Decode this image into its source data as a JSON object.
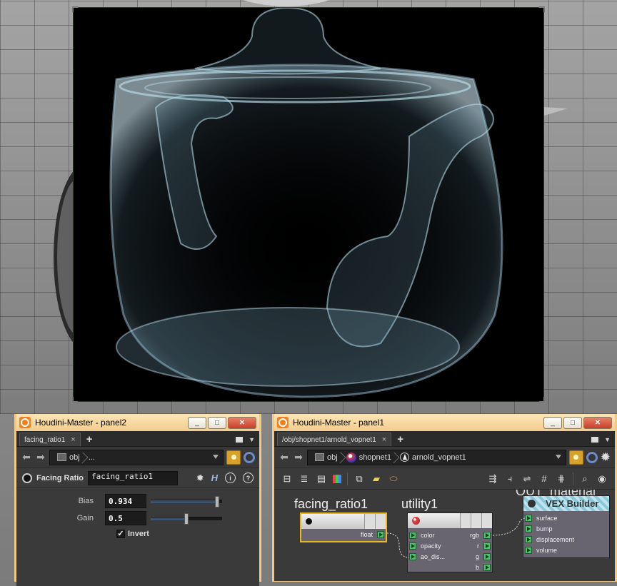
{
  "colors": {
    "panel_border": "#f1c987",
    "selected_node": "#e8b820",
    "port_green": "#4fc26e",
    "vex_builder_tint": "#9fd0e0"
  },
  "panel2": {
    "title": "Houdini-Master - panel2",
    "tab": {
      "label": "facing_ratio1",
      "close": "×"
    },
    "tab_add": "+",
    "path": {
      "crumbs": [
        "obj",
        "..."
      ]
    },
    "node_type": "Facing Ratio",
    "node_name": "facing_ratio1",
    "params": [
      {
        "label": "Bias",
        "value": "0.934",
        "slider": 0.934
      },
      {
        "label": "Gain",
        "value": "0.5",
        "slider": 0.5
      }
    ],
    "invert": {
      "label": "Invert",
      "checked": true,
      "mark": "✓"
    },
    "win_buttons": [
      "_",
      "□",
      "✕"
    ]
  },
  "panel1": {
    "title": "Houdini-Master - panel1",
    "tab": {
      "label": "/obj/shopnet1/arnold_vopnet1",
      "close": "×"
    },
    "tab_add": "+",
    "path": {
      "crumbs": [
        "obj",
        "shopnet1",
        "arnold_vopnet1"
      ]
    },
    "win_buttons": [
      "_",
      "□",
      "✕"
    ],
    "nodes": {
      "facing_ratio": {
        "label": "facing_ratio1",
        "output": "float"
      },
      "utility": {
        "label": "utility1",
        "inputs": [
          "color",
          "opacity",
          "ao_dis..."
        ],
        "outputs": [
          "rgb",
          "r",
          "g",
          "b"
        ]
      },
      "out_material": {
        "label": "OUT_material",
        "badge": "VEX Builder",
        "inputs": [
          "surface",
          "bump",
          "displacement",
          "volume"
        ]
      }
    }
  }
}
